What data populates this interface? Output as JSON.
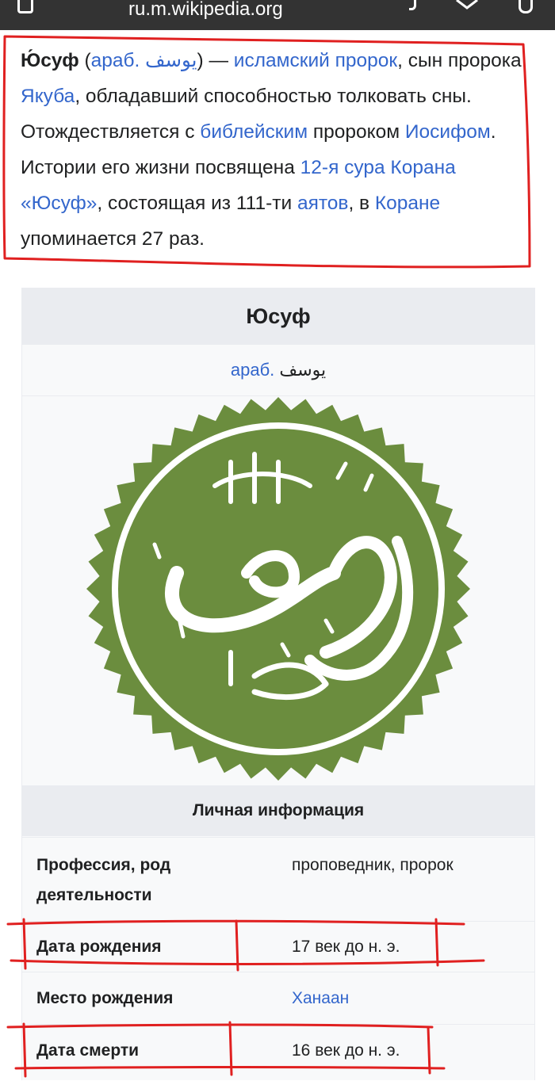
{
  "browser": {
    "url": "ru.m.wikipedia.org"
  },
  "lead": {
    "t1_bold": "Ю́суф",
    "t2": " (",
    "l_arab": "араб. يوسف",
    "t3": ") — ",
    "l_prophet": "исламский пророк",
    "t4": ", сын пророка ",
    "l_yakub": "Якуба",
    "t5": ", обладавший способностью толковать сны. Отождествляется с ",
    "l_bible": "библейским",
    "t6": " пророком ",
    "l_iosif": "Иосифом",
    "t7": ". Истории его жизни посвящена ",
    "l_sura": "12-я сура Корана «Юсуф»",
    "t8": ", состоящая из 111-ти ",
    "l_ayats": "аятов",
    "t9": ", в ",
    "l_koran": "Коране",
    "t10": " упоминается 27 раз."
  },
  "infobox": {
    "title": "Юсуф",
    "arabic_link": "араб.",
    "arabic_text": " يوسف",
    "image_alt_icon": "yusuf-calligraphy-seal",
    "section_header": "Личная информация",
    "rows": [
      {
        "label": "Профессия, род деятельности",
        "value": "проповедник, пророк",
        "link": false
      },
      {
        "label": "Дата рождения",
        "value": "17 век до н. э.",
        "link": false
      },
      {
        "label": "Место рождения",
        "value": "Ханаан",
        "link": true
      },
      {
        "label": "Дата смерти",
        "value": "16 век до н. э.",
        "link": false
      }
    ]
  },
  "colors": {
    "link": "#3366cc",
    "seal_green": "#6b8d3e",
    "annotation_red": "#e02020",
    "header_bg": "#eaecf0",
    "infobox_bg": "#f8f9fa"
  }
}
